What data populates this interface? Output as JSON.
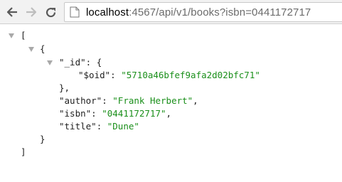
{
  "browser": {
    "url_host": "localhost",
    "url_rest": ":4567/api/v1/books?isbn=0441172717"
  },
  "json": {
    "open_bracket": "[",
    "open_brace": "{",
    "id_key": "\"_id\"",
    "id_after": ": {",
    "oid_key": "\"$oid\"",
    "oid_value": "\"5710a46bfef9afa2d02bfc71\"",
    "close_inner": "},",
    "author_key": "\"author\"",
    "author_value": "\"Frank Herbert\"",
    "isbn_key": "\"isbn\"",
    "isbn_value": "\"0441172717\"",
    "title_key": "\"title\"",
    "title_value": "\"Dune\"",
    "close_brace": "}",
    "close_bracket": "]",
    "colon": ": ",
    "comma": ","
  }
}
